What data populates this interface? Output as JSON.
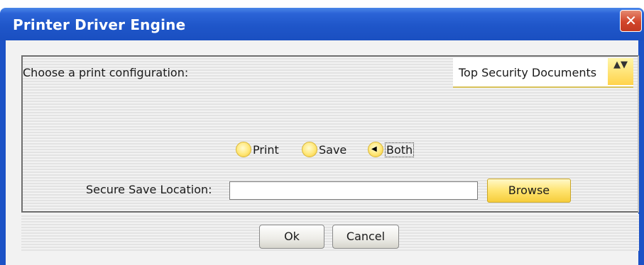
{
  "window": {
    "title": "Printer Driver Engine",
    "close_glyph": "✕"
  },
  "config": {
    "label": "Choose a print configuration:",
    "selected": "Top Security Documents",
    "arrow_glyph": "▲▼"
  },
  "mode": {
    "options": [
      "Print",
      "Save",
      "Both"
    ],
    "selected": "Both"
  },
  "save": {
    "label": "Secure Save Location:",
    "value": "",
    "browse_label": "Browse"
  },
  "actions": {
    "ok_label": "Ok",
    "cancel_label": "Cancel"
  },
  "colors": {
    "titlebar": "#1f56c9",
    "accent_yellow": "#ffe470",
    "close_red": "#d2452a"
  }
}
